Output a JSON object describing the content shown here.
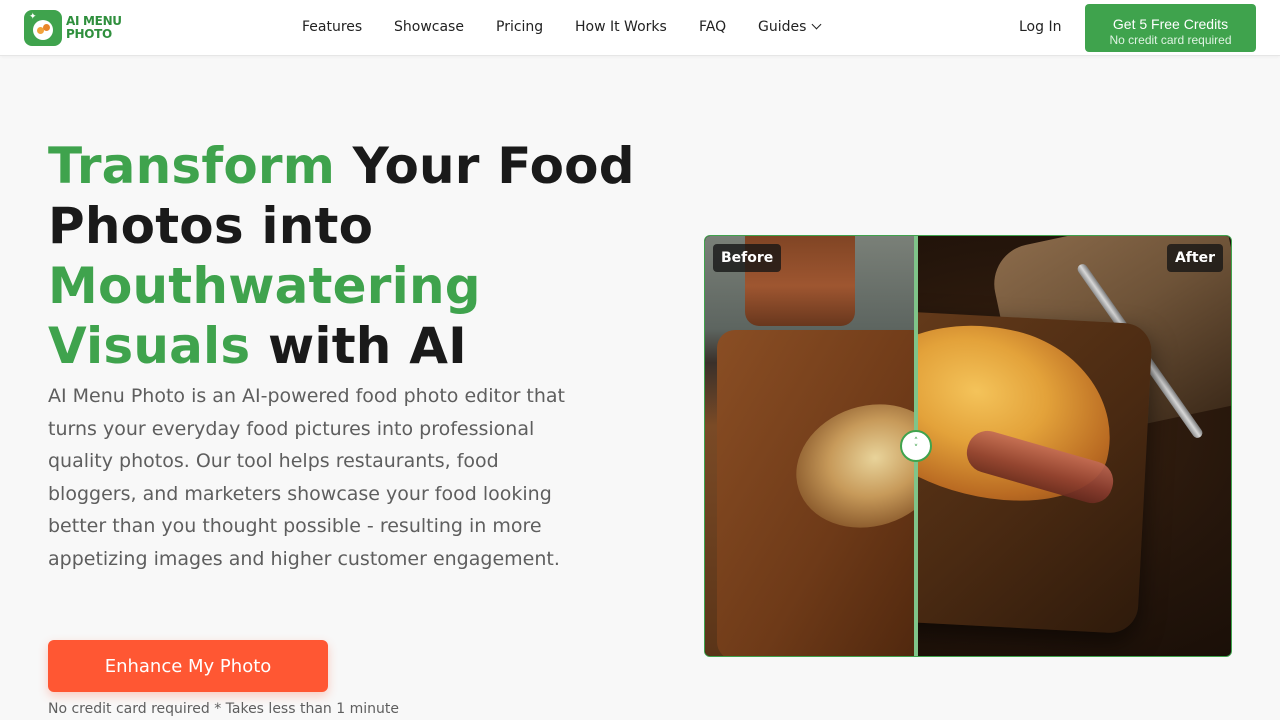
{
  "header": {
    "logo": {
      "line1": "AI MENU",
      "line2": "PHOTO"
    },
    "nav": [
      {
        "label": "Features"
      },
      {
        "label": "Showcase"
      },
      {
        "label": "Pricing"
      },
      {
        "label": "How It Works"
      },
      {
        "label": "FAQ"
      },
      {
        "label": "Guides"
      }
    ],
    "login_label": "Log In",
    "cta": {
      "title": "Get 5 Free Credits",
      "subtitle": "No credit card required"
    }
  },
  "hero": {
    "headline": {
      "part1": "Transform",
      "part2": " Your Food Photos into ",
      "part3": "Mouthwatering Visuals",
      "part4": " with AI"
    },
    "description": "AI Menu Photo is an AI-powered food photo editor that turns your everyday food pictures into professional quality photos. Our tool helps restaurants, food bloggers, and marketers showcase your food looking better than you thought possible - resulting in more appetizing images and higher customer engagement.",
    "button_label": "Enhance My Photo",
    "note": "No credit card required * Takes less than 1 minute"
  },
  "comparison": {
    "before_label": "Before",
    "after_label": "After"
  },
  "colors": {
    "brand_green": "#3fa34d",
    "accent_orange": "#ff5733",
    "page_bg": "#f8f8f8"
  },
  "icons": {
    "logo": "plate-logo-icon",
    "guides_chevron": "chevron-down-icon",
    "slider_handle": "drag-handle-icon"
  }
}
